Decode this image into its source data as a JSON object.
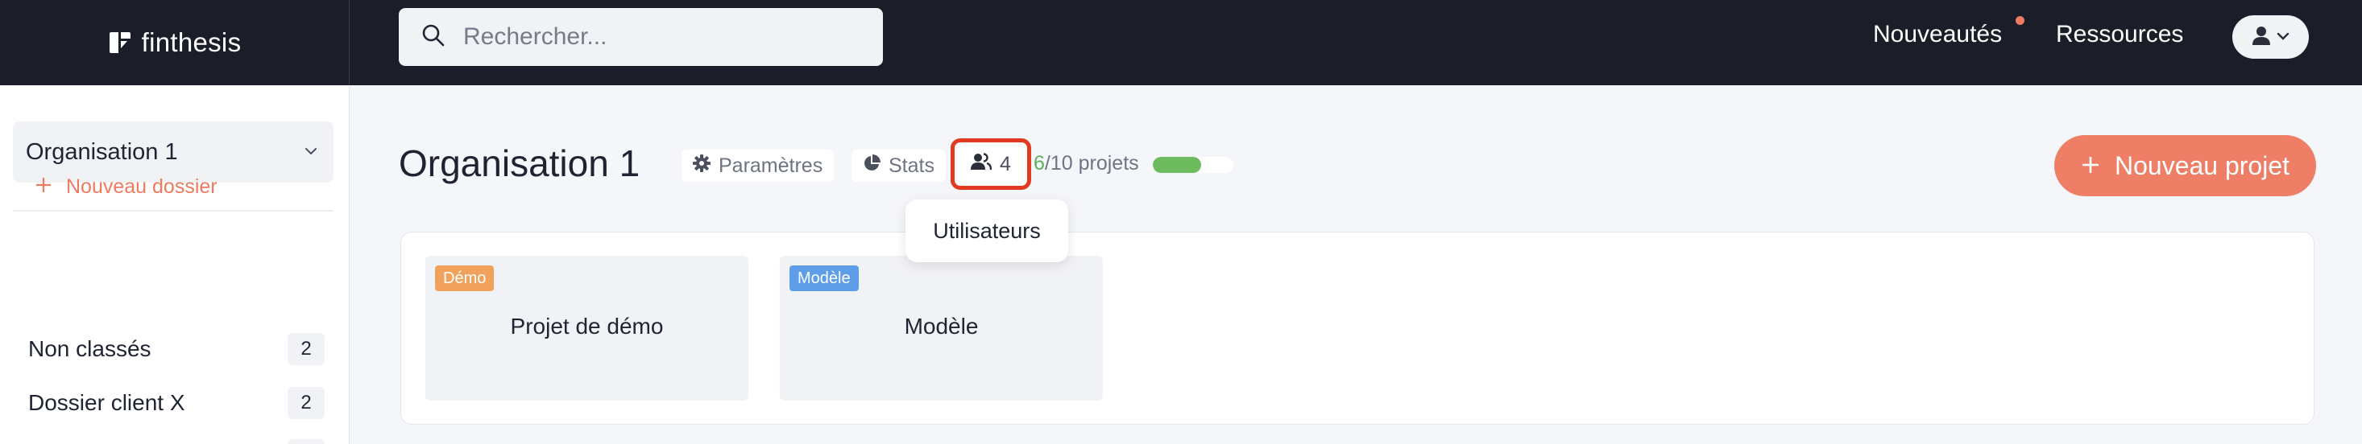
{
  "app": {
    "brand": "finthesis"
  },
  "topbar": {
    "search_placeholder": "Rechercher...",
    "news_label": "Nouveautés",
    "resources_label": "Ressources"
  },
  "sidebar": {
    "org_select": "Organisation 1",
    "new_folder_label": "Nouveau dossier",
    "folders": [
      {
        "name": "Non classés",
        "count": "2"
      },
      {
        "name": "Dossier client X",
        "count": "2"
      }
    ]
  },
  "main": {
    "title": "Organisation 1",
    "params_label": "Paramètres",
    "stats_label": "Stats",
    "users_count": "4",
    "quota_used": "6",
    "quota_rest": "/10 projets",
    "quota_fraction": 0.6,
    "new_project_label": "Nouveau projet",
    "tooltip": "Utilisateurs"
  },
  "projects": [
    {
      "badge": "Démo",
      "title": "Projet de démo",
      "badge_color": "#f0a25c"
    },
    {
      "badge": "Modèle",
      "title": "Modèle",
      "badge_color": "#5e9ee8"
    }
  ],
  "colors": {
    "topbar": "#1b1d28",
    "accent": "#ee7f66",
    "highlight": "#e23a1e",
    "quota_fill": "#6dbb5e"
  }
}
